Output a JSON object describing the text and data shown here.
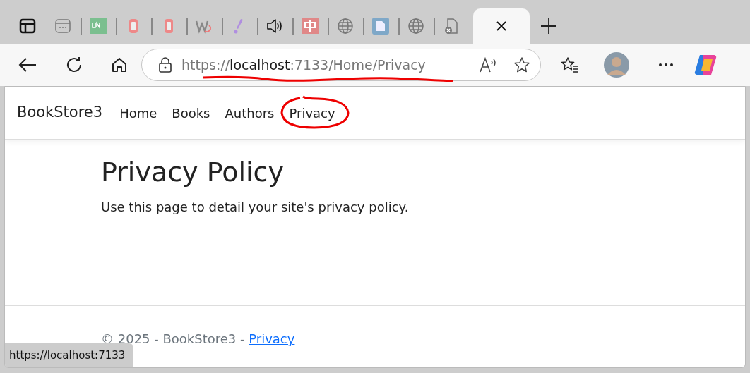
{
  "tabs": [
    {
      "kind": "app",
      "selected": false
    },
    {
      "kind": "window",
      "selected": false
    },
    {
      "kind": "und",
      "selected": false
    },
    {
      "kind": "redo",
      "selected": false
    },
    {
      "kind": "redo",
      "selected": false
    },
    {
      "kind": "w",
      "selected": false
    },
    {
      "kind": "exclaim",
      "selected": false
    },
    {
      "kind": "audio",
      "selected": false
    },
    {
      "kind": "cjk",
      "selected": false
    },
    {
      "kind": "globe",
      "selected": false
    },
    {
      "kind": "doc",
      "selected": false
    },
    {
      "kind": "globe",
      "selected": false
    },
    {
      "kind": "file",
      "selected": false
    },
    {
      "selected": true
    }
  ],
  "address_bar": {
    "scheme": "https://",
    "host": "localhost",
    "rest": ":7133/Home/Privacy"
  },
  "site": {
    "brand": "BookStore3",
    "nav": [
      {
        "label": "Home",
        "circled": false
      },
      {
        "label": "Books",
        "circled": false
      },
      {
        "label": "Authors",
        "circled": false
      },
      {
        "label": "Privacy",
        "circled": true
      }
    ],
    "heading": "Privacy Policy",
    "text": "Use this page to detail your site's privacy policy.",
    "footer": {
      "text": "© 2025 - BookStore3 - ",
      "link": "Privacy"
    }
  },
  "status_bar": "https://localhost:7133"
}
